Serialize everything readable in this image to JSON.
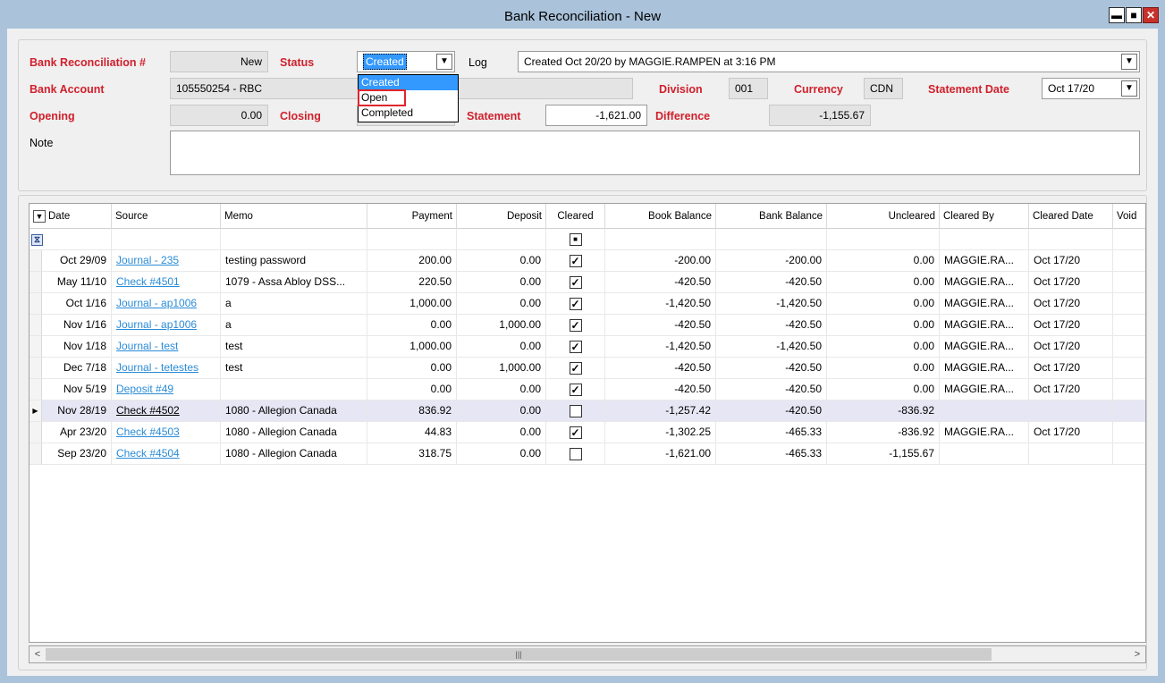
{
  "window": {
    "title": "Bank Reconciliation - New"
  },
  "header": {
    "bank_rec_label": "Bank Reconciliation #",
    "bank_rec_value": "New",
    "status_label": "Status",
    "status_value": "Created",
    "status_options": [
      "Created",
      "Open",
      "Completed"
    ],
    "log_label": "Log",
    "log_value": "Created Oct 20/20 by MAGGIE.RAMPEN at 3:16 PM",
    "bank_account_label": "Bank Account",
    "bank_account_value": "105550254 - RBC",
    "division_label": "Division",
    "division_value": "001",
    "currency_label": "Currency",
    "currency_value": "CDN",
    "statement_date_label": "Statement Date",
    "statement_date_value": "Oct 17/20",
    "opening_label": "Opening",
    "opening_value": "0.00",
    "closing_label": "Closing",
    "statement_label": "Statement",
    "statement_value": "-1,621.00",
    "difference_label": "Difference",
    "difference_value": "-1,155.67",
    "note_label": "Note"
  },
  "grid": {
    "columns": [
      "Date",
      "Source",
      "Memo",
      "Payment",
      "Deposit",
      "Cleared",
      "Book Balance",
      "Bank Balance",
      "Uncleared",
      "Cleared By",
      "Cleared Date",
      "Void"
    ],
    "rows": [
      {
        "date": "Oct 29/09",
        "source": "Journal - 235",
        "memo": "testing password",
        "payment": "200.00",
        "deposit": "0.00",
        "cleared": true,
        "book": "-200.00",
        "bank": "-200.00",
        "uncleared": "0.00",
        "by": "MAGGIE.RA...",
        "cdate": "Oct 17/20"
      },
      {
        "date": "May 11/10",
        "source": "Check #4501",
        "memo": "1079 - Assa Abloy DSS...",
        "payment": "220.50",
        "deposit": "0.00",
        "cleared": true,
        "book": "-420.50",
        "bank": "-420.50",
        "uncleared": "0.00",
        "by": "MAGGIE.RA...",
        "cdate": "Oct 17/20"
      },
      {
        "date": "Oct 1/16",
        "source": "Journal - ap1006",
        "memo": "a",
        "payment": "1,000.00",
        "deposit": "0.00",
        "cleared": true,
        "book": "-1,420.50",
        "bank": "-1,420.50",
        "uncleared": "0.00",
        "by": "MAGGIE.RA...",
        "cdate": "Oct 17/20"
      },
      {
        "date": "Nov 1/16",
        "source": "Journal - ap1006",
        "memo": "a",
        "payment": "0.00",
        "deposit": "1,000.00",
        "cleared": true,
        "book": "-420.50",
        "bank": "-420.50",
        "uncleared": "0.00",
        "by": "MAGGIE.RA...",
        "cdate": "Oct 17/20"
      },
      {
        "date": "Nov 1/18",
        "source": "Journal - test",
        "memo": "test",
        "payment": "1,000.00",
        "deposit": "0.00",
        "cleared": true,
        "book": "-1,420.50",
        "bank": "-1,420.50",
        "uncleared": "0.00",
        "by": "MAGGIE.RA...",
        "cdate": "Oct 17/20"
      },
      {
        "date": "Dec 7/18",
        "source": "Journal - tetestes",
        "memo": "test",
        "payment": "0.00",
        "deposit": "1,000.00",
        "cleared": true,
        "book": "-420.50",
        "bank": "-420.50",
        "uncleared": "0.00",
        "by": "MAGGIE.RA...",
        "cdate": "Oct 17/20"
      },
      {
        "date": "Nov 5/19",
        "source": "Deposit #49",
        "memo": "",
        "payment": "0.00",
        "deposit": "0.00",
        "cleared": true,
        "book": "-420.50",
        "bank": "-420.50",
        "uncleared": "0.00",
        "by": "MAGGIE.RA...",
        "cdate": "Oct 17/20"
      },
      {
        "date": "Nov 28/19",
        "source": "Check #4502",
        "memo": "1080 - Allegion Canada",
        "payment": "836.92",
        "deposit": "0.00",
        "cleared": false,
        "book": "-1,257.42",
        "bank": "-420.50",
        "uncleared": "-836.92",
        "by": "",
        "cdate": ""
      },
      {
        "date": "Apr 23/20",
        "source": "Check #4503",
        "memo": "1080 - Allegion Canada",
        "payment": "44.83",
        "deposit": "0.00",
        "cleared": true,
        "book": "-1,302.25",
        "bank": "-465.33",
        "uncleared": "-836.92",
        "by": "MAGGIE.RA...",
        "cdate": "Oct 17/20"
      },
      {
        "date": "Sep 23/20",
        "source": "Check #4504",
        "memo": "1080 - Allegion Canada",
        "payment": "318.75",
        "deposit": "0.00",
        "cleared": false,
        "book": "-1,621.00",
        "bank": "-465.33",
        "uncleared": "-1,155.67",
        "by": "",
        "cdate": ""
      }
    ]
  }
}
